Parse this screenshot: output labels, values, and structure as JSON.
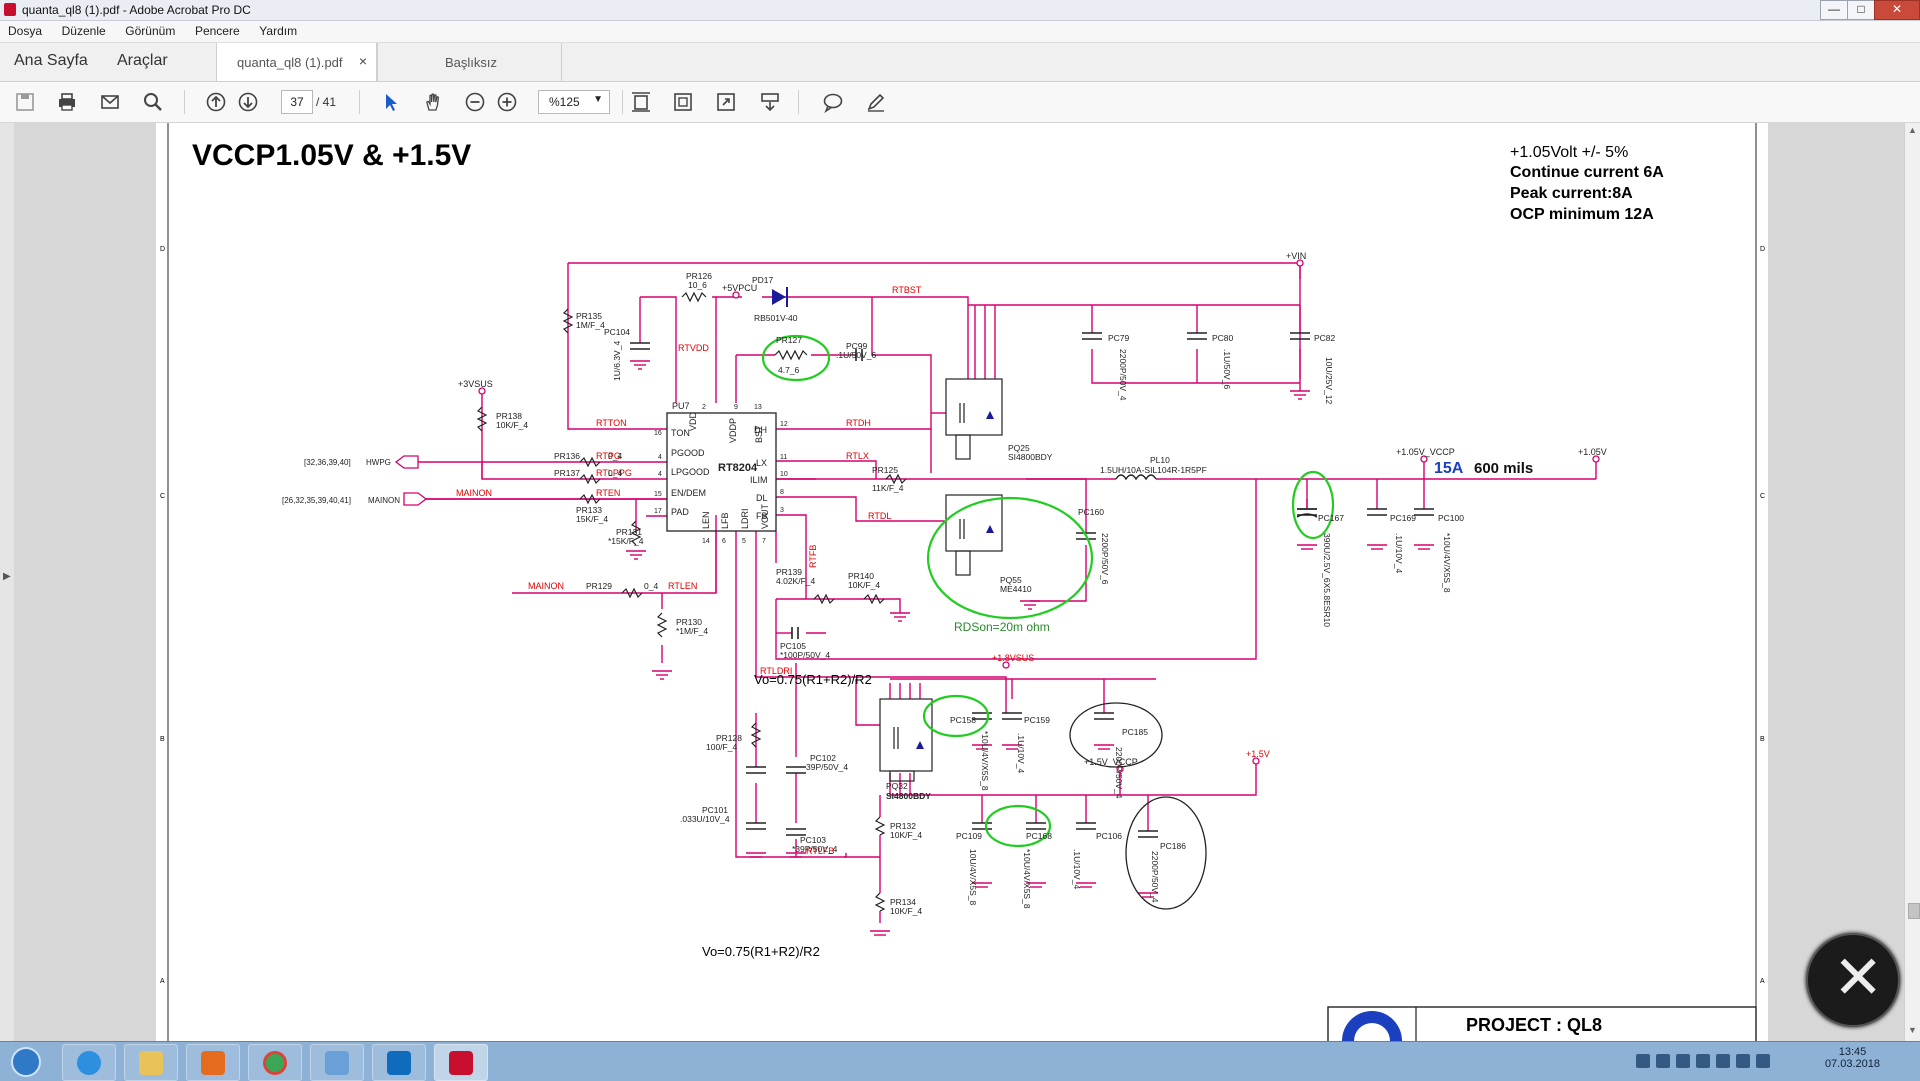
{
  "window": {
    "title": "quanta_ql8 (1).pdf - Adobe Acrobat Pro DC",
    "minimize": "—",
    "maximize": "□",
    "close": "✕"
  },
  "menu": [
    "Dosya",
    "Düzenle",
    "Görünüm",
    "Pencere",
    "Yardım"
  ],
  "nav": {
    "home": "Ana Sayfa",
    "tools": "Araçlar"
  },
  "tabs": [
    {
      "label": "quanta_ql8 (1).pdf",
      "close": "×"
    },
    {
      "label": "Başlıksız"
    }
  ],
  "toolbar": {
    "page_current": "37",
    "page_total": "/ 41",
    "zoom": "%125",
    "zoom_caret": "▼"
  },
  "icons": [
    "save-icon",
    "print-icon",
    "mail-icon",
    "search-icon",
    "page-up-icon",
    "page-down-icon",
    "select-arrow-icon",
    "hand-icon",
    "zoom-out-icon",
    "zoom-in-icon",
    "fit-width-icon",
    "fit-page-icon",
    "full-screen-icon",
    "scroll-mode-icon",
    "comment-icon",
    "sign-icon"
  ],
  "schematic": {
    "title": "VCCP1.05V & +1.5V",
    "specs": [
      "+1.05Volt +/- 5%",
      "Continue current 6A",
      "Peak current:8A",
      "OCP minimum 12A"
    ],
    "current_label": "15A",
    "width_label": "600 mils",
    "vo_formula_1": "Vo=0.75(R1+R2)/R2",
    "vo_formula_2": "Vo=0.75(R1+R2)/R2",
    "rdson": "RDSon=20m ohm",
    "project": "PROJECT : QL8",
    "nets": {
      "vin": "+VIN",
      "v5pcu": "+5VPCU",
      "v3sus": "+3VSUS",
      "v105_vccp": "+1.05V_VCCP",
      "v105": "+1.05V",
      "v18sus": "+1.8VSUS",
      "v15_vccp": "+1.5V_VCCP",
      "v15": "+1.5V"
    },
    "ic": {
      "ref": "PU7",
      "name": "RT8204"
    },
    "pins_left": [
      "TON",
      "PGOOD",
      "LPGOOD",
      "EN/DEM",
      "PAD"
    ],
    "pins_right": [
      "DH",
      "LX",
      "ILIM",
      "DL",
      "FB"
    ],
    "pins_top": [
      "VDD",
      "VDDP",
      "BST"
    ],
    "pins_bottom": [
      "LEN",
      "LFB",
      "LDRI",
      "VOUT"
    ],
    "pin_numbers": {
      "ton": "16",
      "pgood": "4",
      "lpgood": "4",
      "en": "15",
      "pad": "17",
      "dh": "12",
      "lx": "11",
      "ilim": "10",
      "dl": "8",
      "fb": "3",
      "vdd": "2",
      "vddp": "9",
      "bst": "13",
      "len": "14",
      "lfb": "6",
      "ldri": "5",
      "vout": "7"
    },
    "signals": [
      "RTTON",
      "RTPG",
      "RTLPPG",
      "RTEN",
      "RTVDD",
      "RTBST",
      "RTDH",
      "RTLX",
      "RTDL",
      "RTFB",
      "RTLEN",
      "RTLDRI",
      "RTLFB",
      "MAINON",
      "MAINON"
    ],
    "ports": [
      {
        "ref": "[32,36,39,40]",
        "name": "HWPG"
      },
      {
        "ref": "[26,32,35,39,40,41]",
        "name": "MAINON"
      }
    ],
    "parts": [
      {
        "ref": "PR135",
        "val": "1M/F_4"
      },
      {
        "ref": "PR126",
        "val": "10_6"
      },
      {
        "ref": "PC104",
        "val": "1U/6.3V_4"
      },
      {
        "ref": "PD17",
        "val": "RB501V-40"
      },
      {
        "ref": "PR127",
        "val": "4.7_6"
      },
      {
        "ref": "PC99",
        "val": ".1U/50V_6"
      },
      {
        "ref": "PC79",
        "val": "2200P/50V_4"
      },
      {
        "ref": "PC80",
        "val": ".1U/50V_6"
      },
      {
        "ref": "PC82",
        "val": "10U/25V_12"
      },
      {
        "ref": "PR138",
        "val": "10K/F_4"
      },
      {
        "ref": "PR136",
        "val": "0_4"
      },
      {
        "ref": "PR137",
        "val": "0_4"
      },
      {
        "ref": "PR133",
        "val": "15K/F_4"
      },
      {
        "ref": "PR131",
        "val": "*15K/F_4"
      },
      {
        "ref": "PQ25",
        "val": "SI4800BDY"
      },
      {
        "ref": "PR125",
        "val": "11K/F_4"
      },
      {
        "ref": "PL10",
        "val": "1.5UH/10A-SIL104R-1R5PF"
      },
      {
        "ref": "PC160",
        "val": "2200P/50V_6"
      },
      {
        "ref": "PQ55",
        "val": "ME4410"
      },
      {
        "ref": "PC167",
        "val": "390U/2.5V_6X5.8ESR10"
      },
      {
        "ref": "PC169",
        "val": ".1U/10V_4"
      },
      {
        "ref": "PC100",
        "val": "*10U/4V/X5S_8"
      },
      {
        "ref": "PR139",
        "val": "4.02K/F_4"
      },
      {
        "ref": "PR140",
        "val": "10K/F_4"
      },
      {
        "ref": "PC105",
        "val": "*100P/50V_4"
      },
      {
        "ref": "PR129",
        "val": "0_4"
      },
      {
        "ref": "PR130",
        "val": "*1M/F_4"
      },
      {
        "ref": "PQ32",
        "val": "SI4800BDY"
      },
      {
        "ref": "PC158",
        "val": "*10U/4V/X5S_8"
      },
      {
        "ref": "PC159",
        "val": ".1U/10V_4"
      },
      {
        "ref": "PC185",
        "val": "2200P/50V_4"
      },
      {
        "ref": "PR128",
        "val": "100/F_4"
      },
      {
        "ref": "PC102",
        "val": "39P/50V_4"
      },
      {
        "ref": "PC101",
        "val": ".033U/10V_4"
      },
      {
        "ref": "PC103",
        "val": "*39P/50V_4"
      },
      {
        "ref": "PR132",
        "val": "10K/F_4"
      },
      {
        "ref": "PR134",
        "val": "10K/F_4"
      },
      {
        "ref": "PC109",
        "val": "10U/4V/X5S_8"
      },
      {
        "ref": "PC168",
        "val": "*10U/4V/X5S_8"
      },
      {
        "ref": "PC106",
        "val": ".1U/10V_4"
      },
      {
        "ref": "PC186",
        "val": "2200P/50V_4"
      }
    ],
    "edge_letters": [
      "D",
      "C",
      "B",
      "A"
    ]
  },
  "taskbar": {
    "time": "13:45",
    "date": "07.03.2018",
    "apps": [
      "ie-icon",
      "explorer-icon",
      "media-player-icon",
      "chrome-icon",
      "search-tool-icon",
      "outlook-icon",
      "acrobat-icon"
    ]
  },
  "colors": {
    "wire": "#d6006e",
    "label": "#e00000",
    "highlight": "#22cc22",
    "accent_blue": "#1a3fbf",
    "acrobat_red": "#c8102e"
  }
}
